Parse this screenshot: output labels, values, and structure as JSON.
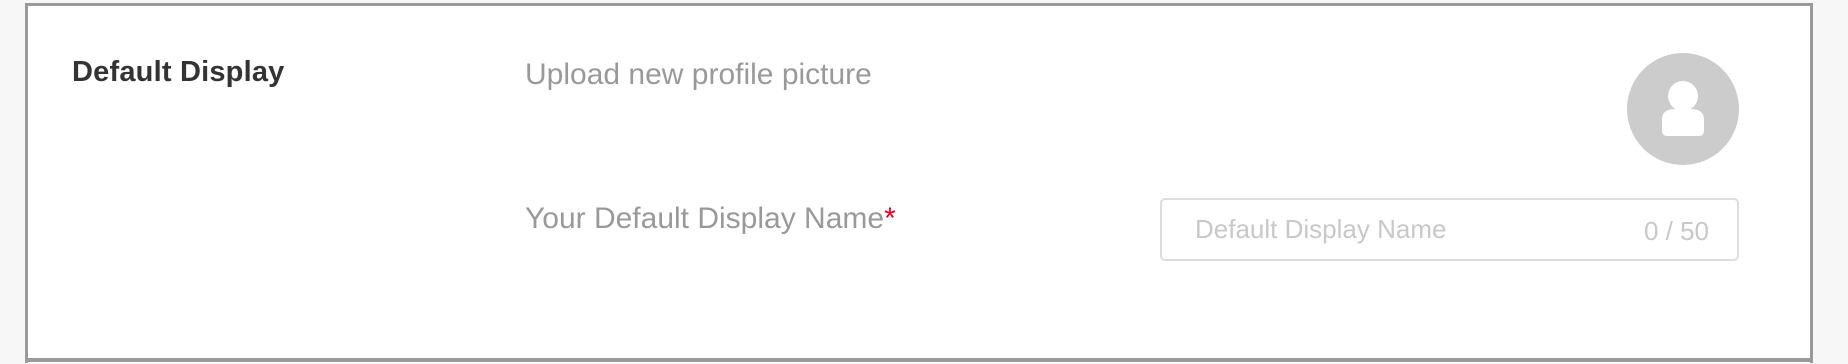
{
  "section": {
    "title": "Default Display"
  },
  "profile_picture": {
    "label": "Upload new profile picture",
    "icon": "user-silhouette-icon"
  },
  "display_name": {
    "label": "Your Default Display Name",
    "required_marker": "*",
    "value": "",
    "placeholder": "Default Display Name",
    "counter": "0 / 50"
  },
  "colors": {
    "required": "#e60026",
    "avatar_bg": "#cccccc",
    "label_text": "#999999",
    "title_text": "#333333"
  }
}
